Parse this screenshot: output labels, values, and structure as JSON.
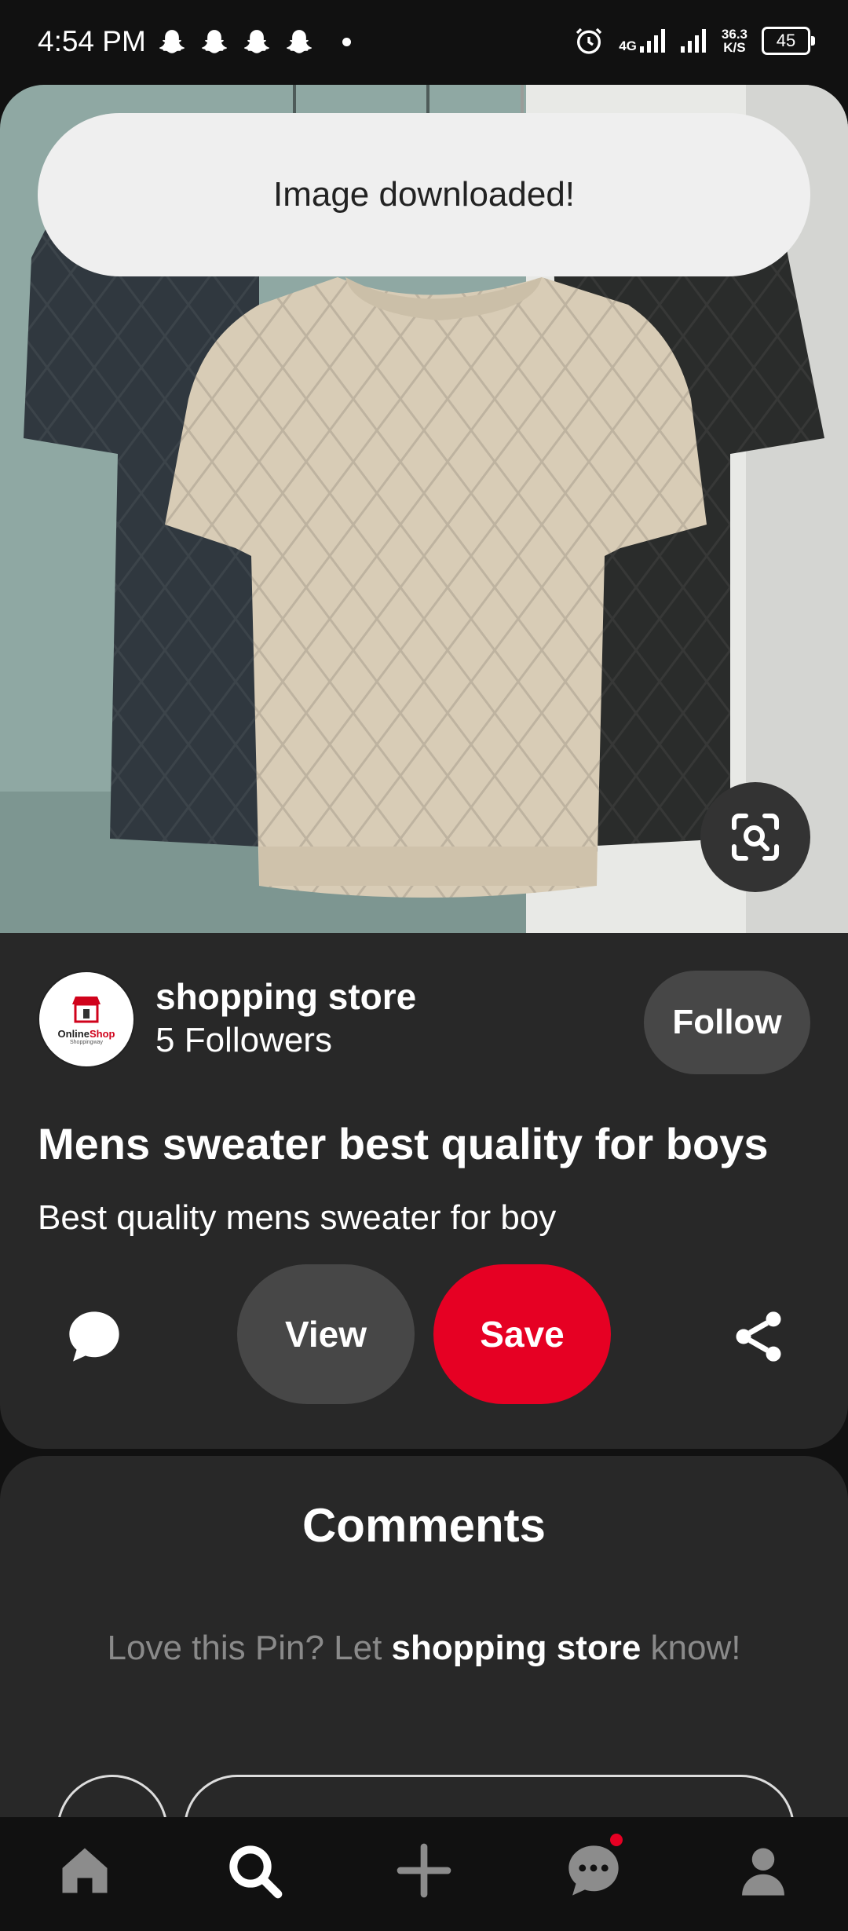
{
  "status_bar": {
    "time": "4:54 PM",
    "network_type": "4G",
    "speed_value": "36.3",
    "speed_unit": "K/S",
    "battery": "45"
  },
  "toast": {
    "message": "Image downloaded!"
  },
  "pin": {
    "store_name": "shopping store",
    "followers": "5 Followers",
    "avatar_text_1": "Online",
    "avatar_text_2": "Shop",
    "avatar_text_3": "Shoppingway",
    "follow_label": "Follow",
    "title": "Mens sweater best quality for boys",
    "description": "Best quality mens sweater for boy",
    "view_label": "View",
    "save_label": "Save"
  },
  "comments": {
    "title": "Comments",
    "prompt_prefix": "Love this Pin? Let ",
    "prompt_name": "shopping store",
    "prompt_suffix": " know!"
  },
  "colors": {
    "accent_red": "#e60023",
    "card_bg": "#282828",
    "button_gray": "#474747"
  },
  "icons": [
    "snapchat-icon",
    "alarm-icon",
    "signal-icon",
    "battery-icon",
    "visual-search-icon",
    "comment-icon",
    "share-icon",
    "home-icon",
    "search-icon",
    "plus-icon",
    "messages-icon",
    "profile-icon"
  ]
}
